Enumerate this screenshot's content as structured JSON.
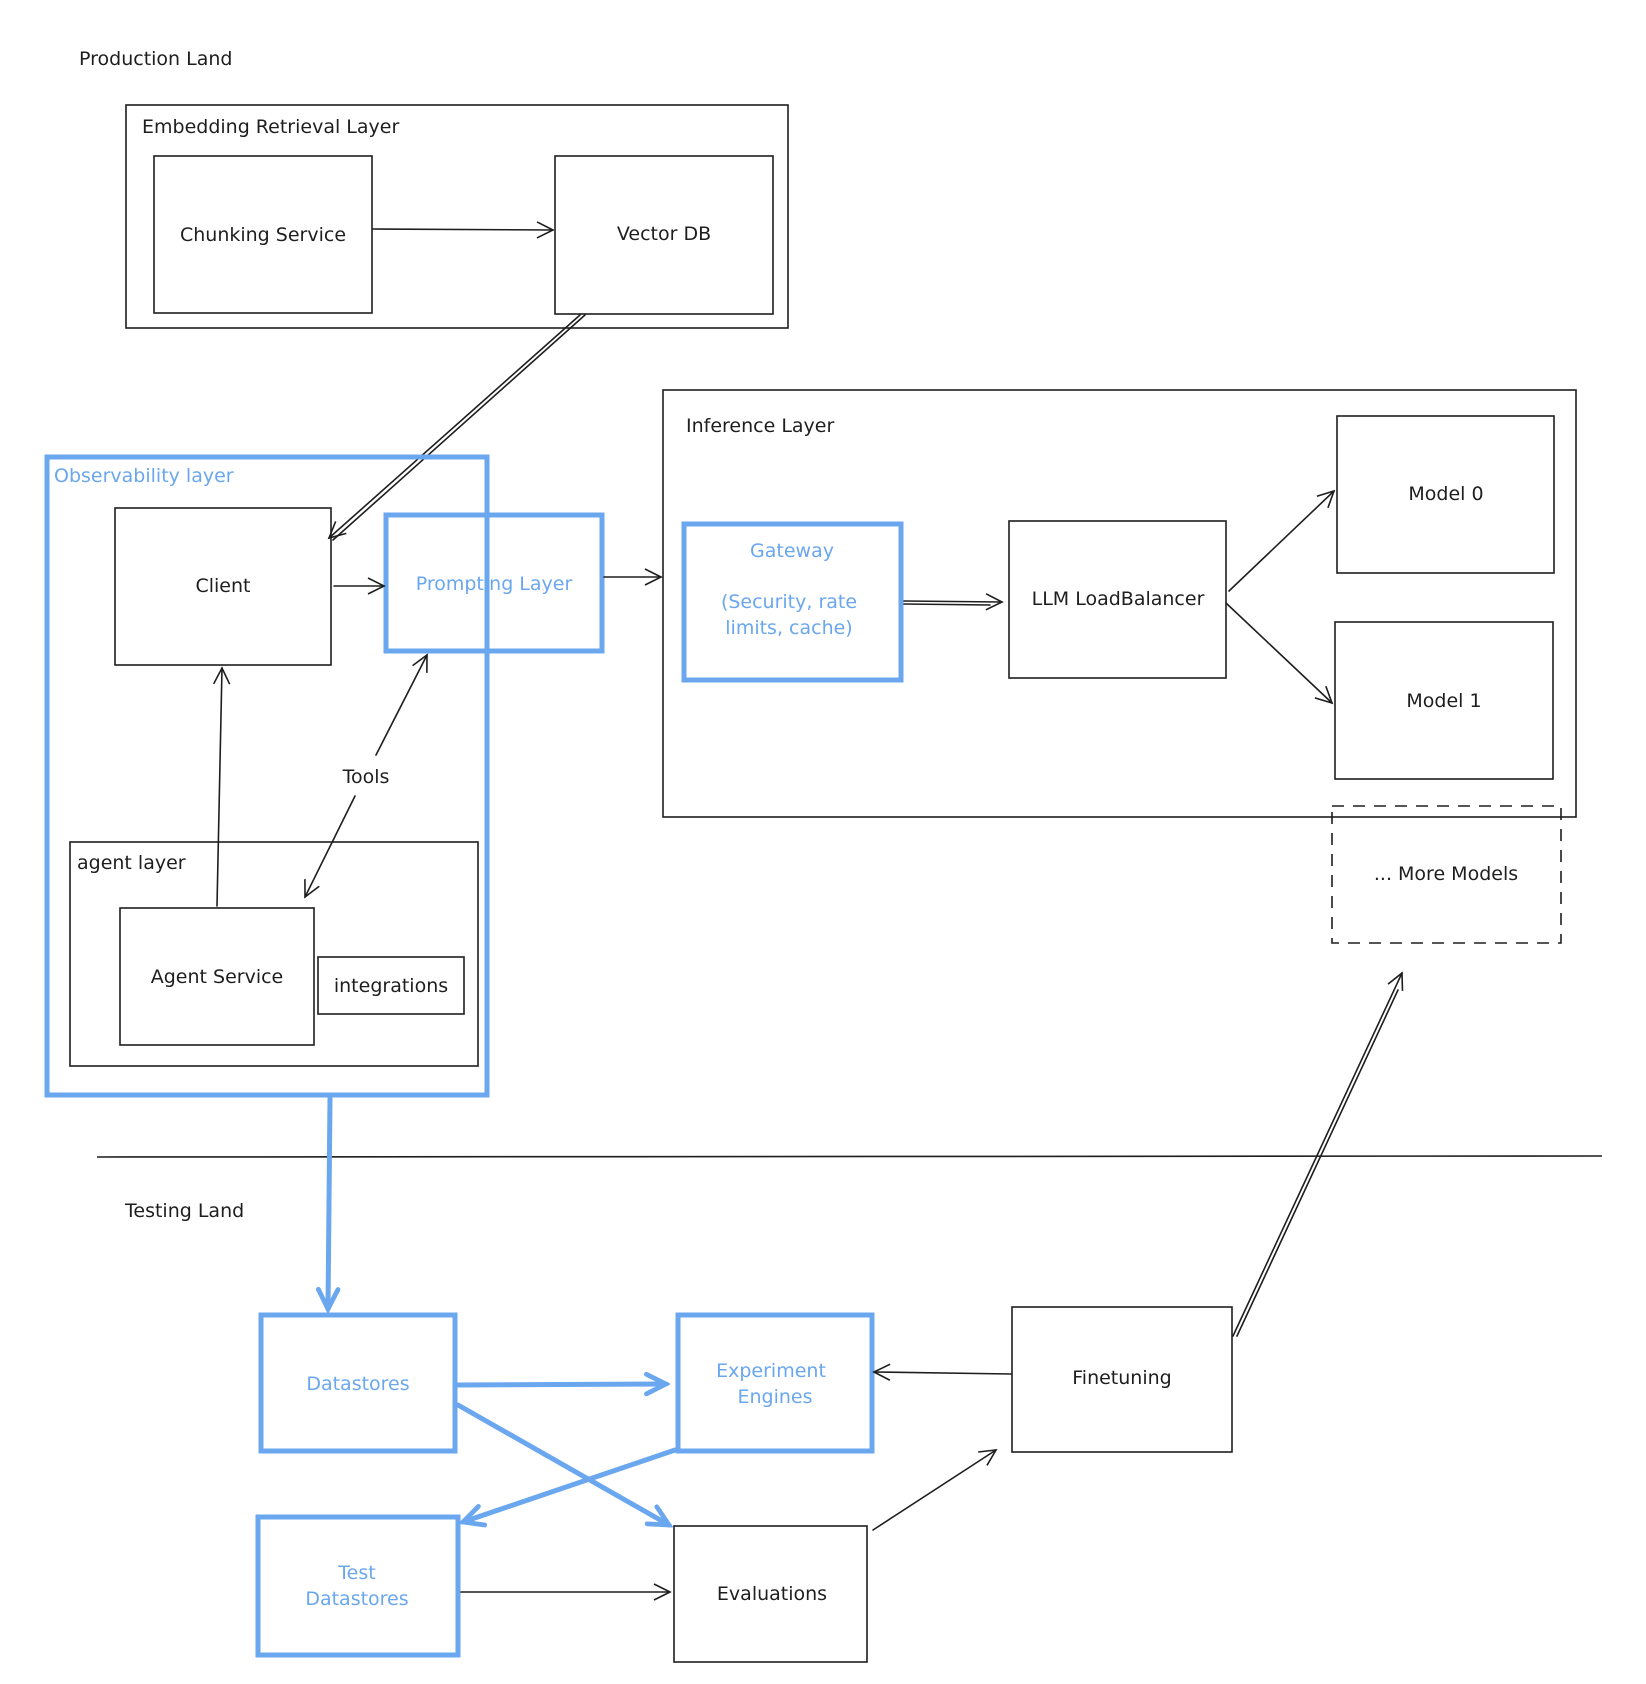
{
  "regions": {
    "production": "Production Land",
    "testing": "Testing Land"
  },
  "groups": {
    "embedding": "Embedding Retrieval Layer",
    "observability": "Observability layer",
    "inference": "Inference Layer",
    "agent": "agent layer"
  },
  "nodes": {
    "chunking": "Chunking Service",
    "vectordb": "Vector DB",
    "client": "Client",
    "prompting": "Prompting Layer",
    "gateway_title": "Gateway",
    "gateway_line1": "(Security, rate",
    "gateway_line2": "limits, cache)",
    "loadbalancer": "LLM LoadBalancer",
    "model0": "Model 0",
    "model1": "Model 1",
    "more_models": "... More Models",
    "agent_service": "Agent Service",
    "integrations": "integrations",
    "datastores": "Datastores",
    "experiment_line1": "Experiment",
    "experiment_line2": "Engines",
    "test_ds_line1": "Test",
    "test_ds_line2": "Datastores",
    "evaluations": "Evaluations",
    "finetuning": "Finetuning"
  },
  "edge_labels": {
    "tools": "Tools"
  },
  "colors": {
    "highlight": "#6aa7ee",
    "ink": "#1e1e1e"
  }
}
